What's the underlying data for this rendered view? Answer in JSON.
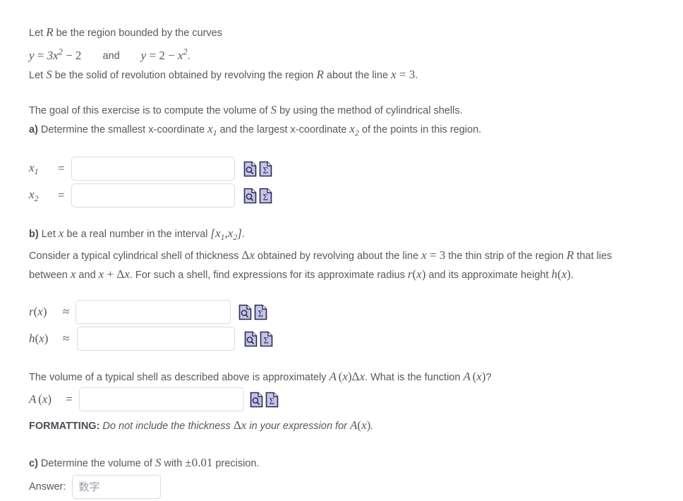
{
  "problem": {
    "intro_line1_pre": "Let ",
    "intro_line1_R": "R",
    "intro_line1_post": " be the region bounded by the curves",
    "eq1": "y = 3x2 − 2",
    "and": "and",
    "eq2": "y = 2 − x2.",
    "intro_line2_pre": "Let ",
    "intro_line2_S": "S",
    "intro_line2_mid": " be the solid of revolution obtained by revolving the region ",
    "intro_line2_R": "R",
    "intro_line2_post2": " about the line ",
    "intro_line2_eq": "x = 3",
    "intro_line2_end": ".",
    "goal_pre": "The goal of this exercise is to compute the volume of ",
    "goal_S": "S",
    "goal_post": " by using the method of cylindrical shells."
  },
  "part_a": {
    "label": "a)",
    "text_pre": " Determine the smallest x-coordinate ",
    "x1": "x1",
    "text_mid": " and the largest x-coordinate ",
    "x2": "x2",
    "text_post": " of the points in this region.",
    "fields": [
      {
        "name": "x1",
        "label": "x1",
        "relation": "=",
        "value": "",
        "placeholder": ""
      },
      {
        "name": "x2",
        "label": "x2",
        "relation": "=",
        "value": "",
        "placeholder": ""
      }
    ]
  },
  "part_b": {
    "label": "b)",
    "line1_pre": " Let ",
    "line1_x": "x",
    "line1_mid": " be a real number in the interval ",
    "line1_interval": "[x1, x2]",
    "line1_end": ".",
    "para_1": "Consider a typical cylindrical shell of thickness ",
    "delta_x": "Δx",
    "para_2": " obtained by revolving about the line ",
    "eq_x3": "x = 3",
    "para_3": " the thin strip of the region ",
    "R": "R",
    "para_4": " that lies between ",
    "x": "x",
    "para_5": " and ",
    "x_plus_dx": "x + Δx",
    "para_6": ". For such a shell, find expressions for its approximate radius ",
    "rx": "r(x)",
    "para_7": " and its approximate height ",
    "hx": "h(x)",
    "para_8": ".",
    "fields": [
      {
        "name": "r",
        "label": "r(x)",
        "relation": "≈",
        "value": "",
        "placeholder": ""
      },
      {
        "name": "h",
        "label": "h(x)",
        "relation": "≈",
        "value": "",
        "placeholder": ""
      }
    ],
    "volume_pre": "The volume of a typical shell as described above is approximately ",
    "volume_expr": "A(x)Δx",
    "volume_mid": ". What is the function ",
    "volume_Ax": "A(x)",
    "volume_post": "?",
    "area_field": {
      "name": "A",
      "label": "A(x)",
      "relation": "=",
      "value": "",
      "placeholder": ""
    },
    "formatting_label": "FORMATTING:",
    "formatting_pre": " Do not include the thickness ",
    "formatting_dx": "Δx",
    "formatting_mid": " in your expression for ",
    "formatting_Ax": "A(x)",
    "formatting_end": "."
  },
  "part_c": {
    "label": "c)",
    "text_pre": " Determine the volume of ",
    "S": "S",
    "text_mid": " with ",
    "precision": "±0.01",
    "text_post": " precision.",
    "answer_label": "Answer:",
    "answer_value": "",
    "answer_placeholder": "数字"
  },
  "icons": {
    "preview": "document-magnifier-icon",
    "symbolic": "document-sigma-icon",
    "preview_title": "Preview",
    "symbolic_title": "Symbolic formula entry"
  },
  "colors": {
    "text": "#555860",
    "icon_fill": "#c5c5e8",
    "icon_stroke": "#2a2a50",
    "input_border": "#dcdcdc",
    "placeholder": "#9a9aa5"
  }
}
